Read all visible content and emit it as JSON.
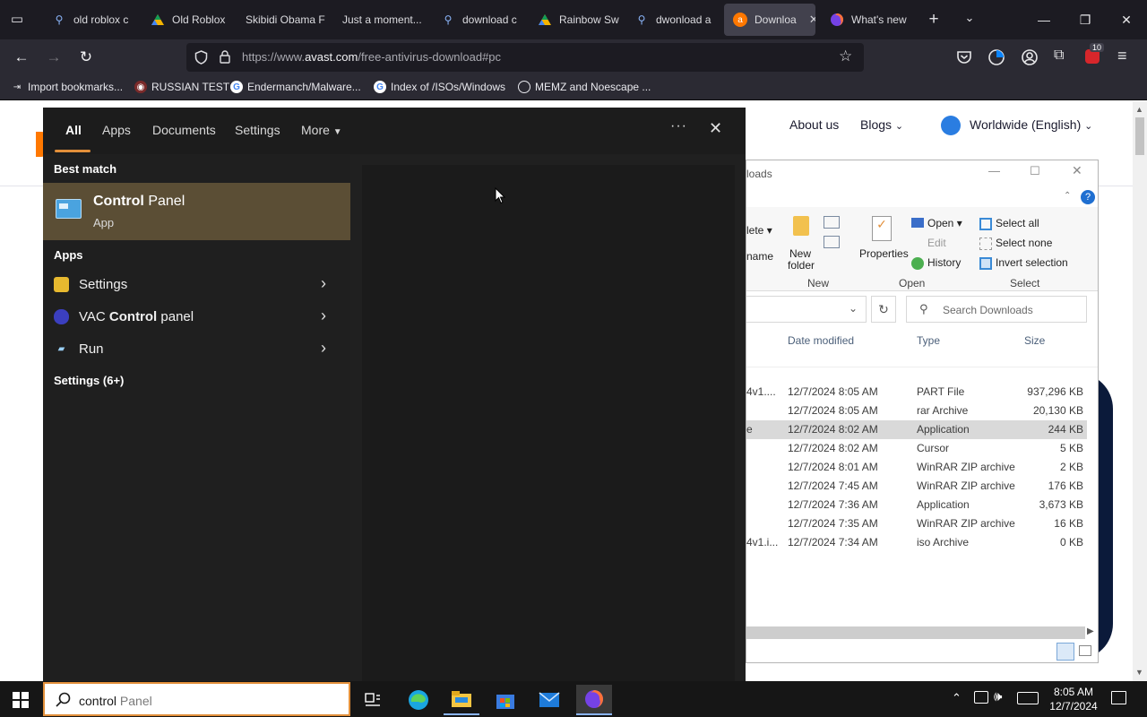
{
  "browser": {
    "tabs": [
      {
        "label": "old roblox c",
        "icon": "search-icon"
      },
      {
        "label": "Old Roblox",
        "icon": "drive-icon"
      },
      {
        "label": "Skibidi Obama F",
        "icon": ""
      },
      {
        "label": "Just a moment...",
        "icon": ""
      },
      {
        "label": "download c",
        "icon": "search-icon"
      },
      {
        "label": "Rainbow Sw",
        "icon": "drive-icon"
      },
      {
        "label": "dwonload a",
        "icon": "search-icon"
      },
      {
        "label": "Downloa",
        "icon": "avast-icon",
        "active": true
      },
      {
        "label": "What's new",
        "icon": "firefox-icon"
      }
    ],
    "url_prefix": "https://www.",
    "url_domain": "avast.com",
    "url_path": "/free-antivirus-download#pc",
    "extension_badge": "10",
    "bookmarks": [
      {
        "label": "Import bookmarks..."
      },
      {
        "label": "RUSSIAN TEST"
      },
      {
        "label": "Endermanch/Malware..."
      },
      {
        "label": "Index of /ISOs/Windows"
      },
      {
        "label": "MEMZ and Noescape ..."
      }
    ]
  },
  "page": {
    "nav": {
      "about": "About us",
      "blogs": "Blogs",
      "region": "Worldwide (English)"
    }
  },
  "explorer": {
    "title": "loads",
    "ribbon": {
      "delete": "lete",
      "rename": "name",
      "new_folder_1": "New",
      "new_folder_2": "folder",
      "group_new": "New",
      "properties": "Properties",
      "open": "Open",
      "edit": "Edit",
      "history": "History",
      "group_open": "Open",
      "select_all": "Select all",
      "select_none": "Select none",
      "invert_selection": "Invert selection",
      "group_select": "Select"
    },
    "search_placeholder": "Search Downloads",
    "columns": {
      "date": "Date modified",
      "type": "Type",
      "size": "Size"
    },
    "rows": [
      {
        "name": "4v1....",
        "date": "12/7/2024 8:05 AM",
        "type": "PART File",
        "size": "937,296 KB"
      },
      {
        "name": "",
        "date": "12/7/2024 8:05 AM",
        "type": "rar Archive",
        "size": "20,130 KB"
      },
      {
        "name": "e",
        "date": "12/7/2024 8:02 AM",
        "type": "Application",
        "size": "244 KB",
        "selected": true
      },
      {
        "name": "",
        "date": "12/7/2024 8:02 AM",
        "type": "Cursor",
        "size": "5 KB"
      },
      {
        "name": "",
        "date": "12/7/2024 8:01 AM",
        "type": "WinRAR ZIP archive",
        "size": "2 KB"
      },
      {
        "name": "",
        "date": "12/7/2024 7:45 AM",
        "type": "WinRAR ZIP archive",
        "size": "176 KB"
      },
      {
        "name": "",
        "date": "12/7/2024 7:36 AM",
        "type": "Application",
        "size": "3,673 KB"
      },
      {
        "name": "",
        "date": "12/7/2024 7:35 AM",
        "type": "WinRAR ZIP archive",
        "size": "16 KB"
      },
      {
        "name": "4v1.i...",
        "date": "12/7/2024 7:34 AM",
        "type": "iso Archive",
        "size": "0 KB"
      }
    ]
  },
  "start": {
    "tabs": [
      "All",
      "Apps",
      "Documents",
      "Settings",
      "More"
    ],
    "best_match_heading": "Best match",
    "best_match": {
      "title_bold": "Control",
      "title_rest": " Panel",
      "subtitle": "App"
    },
    "apps_heading": "Apps",
    "apps": [
      {
        "pre": "",
        "bold": "",
        "post": "Settings"
      },
      {
        "pre": "VAC ",
        "bold": "Control",
        "post": " panel"
      },
      {
        "pre": "",
        "bold": "",
        "post": "Run"
      }
    ],
    "settings_heading": "Settings (6+)"
  },
  "taskbar": {
    "search_typed": "control",
    "search_hint": " Panel",
    "time": "8:05 AM",
    "date": "12/7/2024"
  }
}
